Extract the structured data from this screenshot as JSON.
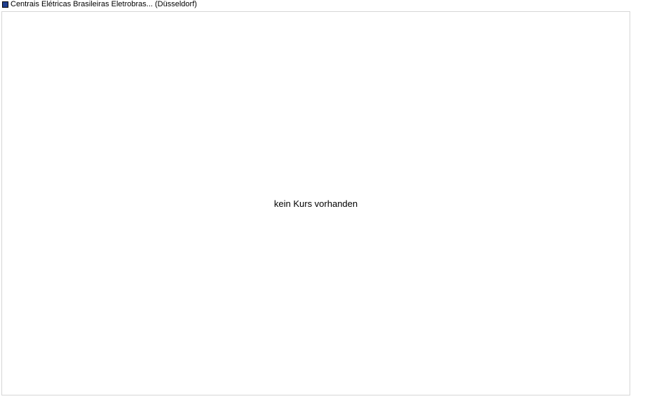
{
  "chart_data": {
    "type": "line",
    "series": [
      {
        "name": "Centrais Elétricas Brasileiras Eletrobras... (Düsseldorf)",
        "color": "#1f3f8f",
        "values": []
      }
    ],
    "legend_placement": "top-left",
    "grid": false,
    "message": "kein Kurs vorhanden"
  }
}
